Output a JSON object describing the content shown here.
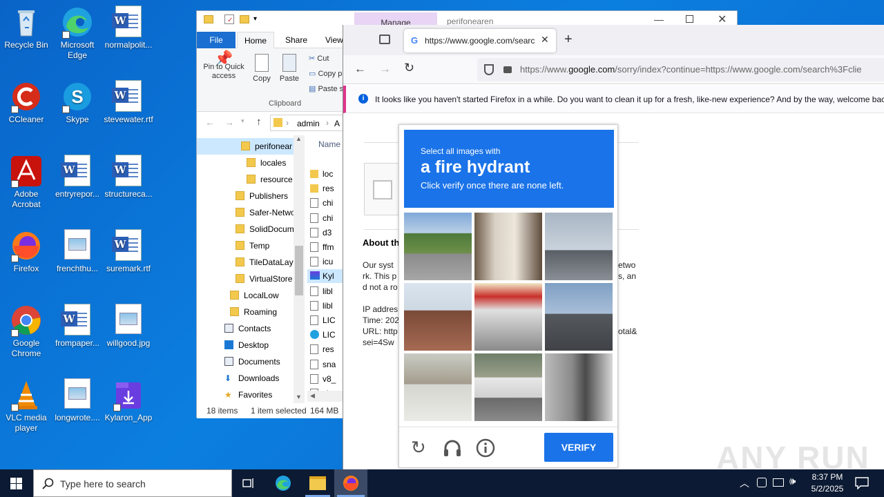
{
  "desktop": {
    "icons": [
      {
        "label": "Recycle Bin",
        "icon": "recycle-bin-icon"
      },
      {
        "label": "Microsoft Edge",
        "icon": "edge-icon"
      },
      {
        "label": "normalpolit...",
        "icon": "word-doc-icon"
      },
      {
        "label": "CCleaner",
        "icon": "ccleaner-icon"
      },
      {
        "label": "Skype",
        "icon": "skype-icon"
      },
      {
        "label": "stevewater.rtf",
        "icon": "word-doc-icon"
      },
      {
        "label": "Adobe Acrobat",
        "icon": "acrobat-icon"
      },
      {
        "label": "entryrepor...",
        "icon": "word-doc-icon"
      },
      {
        "label": "structureca...",
        "icon": "word-doc-icon"
      },
      {
        "label": "Firefox",
        "icon": "firefox-icon"
      },
      {
        "label": "frenchthu...",
        "icon": "image-file-icon"
      },
      {
        "label": "suremark.rtf",
        "icon": "word-doc-icon"
      },
      {
        "label": "Google Chrome",
        "icon": "chrome-icon"
      },
      {
        "label": "frompaper...",
        "icon": "word-doc-icon"
      },
      {
        "label": "willgood.jpg",
        "icon": "image-file-icon"
      },
      {
        "label": "VLC media player",
        "icon": "vlc-icon"
      },
      {
        "label": "longwrote....",
        "icon": "image-file-icon"
      },
      {
        "label": "Kylaron_App",
        "icon": "installer-icon"
      }
    ]
  },
  "explorer": {
    "manage_tab": "Manage",
    "window_title": "perifonearen",
    "ribbon_tabs": [
      "File",
      "Home",
      "Share",
      "View"
    ],
    "clipboard": {
      "pin": "Pin to Quick access",
      "copy": "Copy",
      "paste": "Paste",
      "cut": "Cut",
      "copy_path": "Copy p",
      "paste_shortcut": "Paste s",
      "group": "Clipboard"
    },
    "address": [
      "admin",
      "A"
    ],
    "tree": [
      "perifonear",
      "locales",
      "resource",
      "Publishers",
      "Safer-Netwo",
      "SolidDocum",
      "Temp",
      "TileDataLay",
      "VirtualStore",
      "LocalLow",
      "Roaming",
      "Contacts",
      "Desktop",
      "Documents",
      "Downloads",
      "Favorites"
    ],
    "column_name": "Name",
    "files": [
      "loc",
      "res",
      "chi",
      "chi",
      "d3",
      "ffm",
      "icu",
      "Kyl",
      "libl",
      "libl",
      "LIC",
      "LIC",
      "res",
      "sna",
      "v8_",
      "vk_"
    ],
    "status": {
      "items": "18 items",
      "selected": "1 item selected",
      "size": "164 MB"
    }
  },
  "browser": {
    "tab_title": "https://www.google.com/searc",
    "url_prefix": "https://www.",
    "url_domain": "google.com",
    "url_rest": "/sorry/index?continue=https://www.google.com/search%3Fclie",
    "notification": "It looks like you haven't started Firefox in a while. Do you want to clean it up for a fresh, like-new experience? And by the way, welcome back",
    "page": {
      "about": "About th",
      "para1": [
        "Our syst",
        "rk. This p",
        "d not a ro"
      ],
      "para1_right": [
        "etwo",
        "s, an",
        ""
      ],
      "ip": "IP addres",
      "time": "Time: 202",
      "url": "URL: http",
      "sei": "sei=4Sw",
      "url_right": "otal&"
    }
  },
  "captcha": {
    "prompt": "Select all images with",
    "target": "a fire hydrant",
    "instruction": "Click verify once there are none left.",
    "verify": "VERIFY",
    "accent": "#1a73e8"
  },
  "watermark": "ANY RUN",
  "taskbar": {
    "search_placeholder": "Type here to search",
    "time": "8:37 PM",
    "date": "5/2/2025"
  }
}
